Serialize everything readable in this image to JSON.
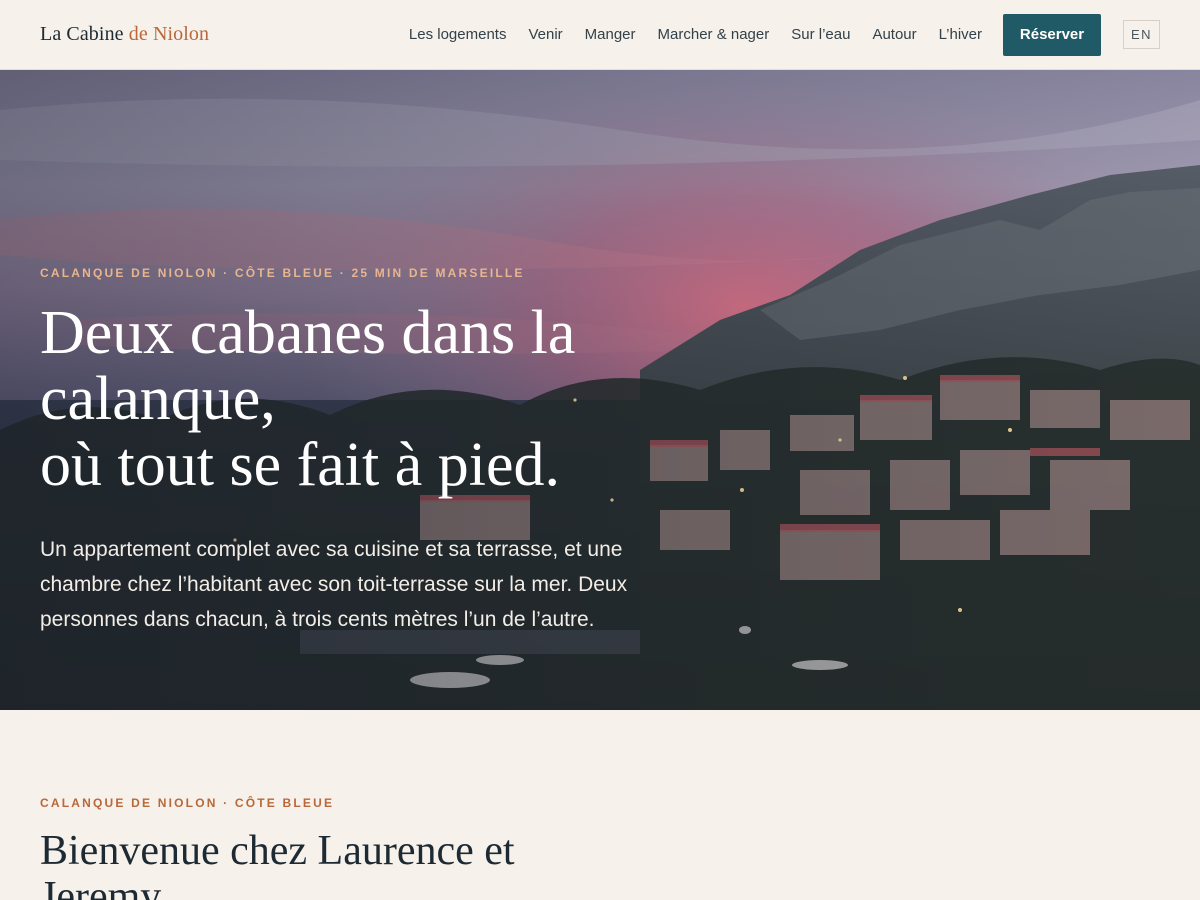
{
  "header": {
    "brand_primary": "La Cabine",
    "brand_accent": "de Niolon",
    "nav": [
      {
        "label": "Les logements"
      },
      {
        "label": "Venir"
      },
      {
        "label": "Manger"
      },
      {
        "label": "Marcher & nager"
      },
      {
        "label": "Sur l’eau"
      },
      {
        "label": "Autour"
      },
      {
        "label": "L’hiver"
      }
    ],
    "cta_label": "Réserver",
    "lang_label": "EN"
  },
  "hero": {
    "eyebrow": "CALANQUE DE NIOLON · CÔTE BLEUE · 25 MIN DE MARSEILLE",
    "title_lines": [
      "Deux cabanes dans la",
      "calanque,",
      "où tout se fait à pied."
    ],
    "lead": "Un appartement complet avec sa cuisine et sa terrasse, et une chambre chez l’habitant avec son toit-terrasse sur la mer. Deux personnes dans chacun, à trois cents mètres l’un de l’autre."
  },
  "welcome": {
    "eyebrow": "CALANQUE DE NIOLON · CÔTE BLEUE",
    "title": "Bienvenue chez Laurence et Jeremy"
  },
  "colors": {
    "background": "#f6f1ea",
    "ink": "#1d2a33",
    "accent": "#b8683a",
    "button": "#1f5a66",
    "hero_eyebrow": "#e9b48e"
  }
}
